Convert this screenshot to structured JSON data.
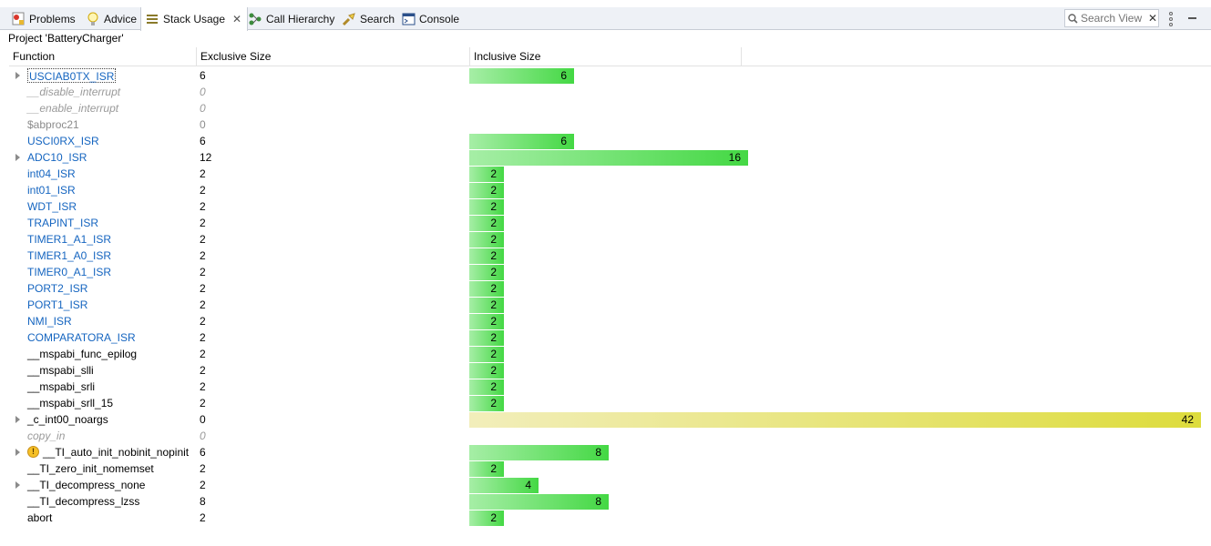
{
  "tabs": [
    {
      "label": "Problems",
      "icon": "problems-icon"
    },
    {
      "label": "Advice",
      "icon": "lightbulb-icon"
    },
    {
      "label": "Stack Usage",
      "icon": "stack-usage-icon",
      "active": true
    },
    {
      "label": "Call Hierarchy",
      "icon": "call-hierarchy-icon"
    },
    {
      "label": "Search",
      "icon": "search-flashlight-icon"
    },
    {
      "label": "Console",
      "icon": "console-icon"
    }
  ],
  "search_view": {
    "placeholder": "Search View"
  },
  "project_label": "Project 'BatteryCharger'",
  "columns": {
    "function": "Function",
    "exclusive": "Exclusive Size",
    "inclusive": "Inclusive Size"
  },
  "bar_scale_max": 42,
  "colors": {
    "link": "#1565c0",
    "bar_green": "#44d844",
    "bar_yellow": "#dddc3c"
  },
  "rows": [
    {
      "name": "USCIAB0TX_ISR",
      "exclusive": "6",
      "inclusive": 6,
      "style": "link",
      "expandable": true,
      "selected": true
    },
    {
      "name": "__disable_interrupt",
      "exclusive": "0",
      "inclusive": null,
      "style": "muted"
    },
    {
      "name": "__enable_interrupt",
      "exclusive": "0",
      "inclusive": null,
      "style": "muted"
    },
    {
      "name": "$abproc21",
      "exclusive": "0",
      "inclusive": null,
      "style": "gray"
    },
    {
      "name": "USCI0RX_ISR",
      "exclusive": "6",
      "inclusive": 6,
      "style": "link"
    },
    {
      "name": "ADC10_ISR",
      "exclusive": "12",
      "inclusive": 16,
      "style": "link",
      "expandable": true
    },
    {
      "name": "int04_ISR",
      "exclusive": "2",
      "inclusive": 2,
      "style": "link"
    },
    {
      "name": "int01_ISR",
      "exclusive": "2",
      "inclusive": 2,
      "style": "link"
    },
    {
      "name": "WDT_ISR",
      "exclusive": "2",
      "inclusive": 2,
      "style": "link"
    },
    {
      "name": "TRAPINT_ISR",
      "exclusive": "2",
      "inclusive": 2,
      "style": "link"
    },
    {
      "name": "TIMER1_A1_ISR",
      "exclusive": "2",
      "inclusive": 2,
      "style": "link"
    },
    {
      "name": "TIMER1_A0_ISR",
      "exclusive": "2",
      "inclusive": 2,
      "style": "link"
    },
    {
      "name": "TIMER0_A1_ISR",
      "exclusive": "2",
      "inclusive": 2,
      "style": "link"
    },
    {
      "name": "PORT2_ISR",
      "exclusive": "2",
      "inclusive": 2,
      "style": "link"
    },
    {
      "name": "PORT1_ISR",
      "exclusive": "2",
      "inclusive": 2,
      "style": "link"
    },
    {
      "name": "NMI_ISR",
      "exclusive": "2",
      "inclusive": 2,
      "style": "link"
    },
    {
      "name": "COMPARATORA_ISR",
      "exclusive": "2",
      "inclusive": 2,
      "style": "link"
    },
    {
      "name": "__mspabi_func_epilog",
      "exclusive": "2",
      "inclusive": 2,
      "style": "plain"
    },
    {
      "name": "__mspabi_slli",
      "exclusive": "2",
      "inclusive": 2,
      "style": "plain"
    },
    {
      "name": "__mspabi_srli",
      "exclusive": "2",
      "inclusive": 2,
      "style": "plain"
    },
    {
      "name": "__mspabi_srll_15",
      "exclusive": "2",
      "inclusive": 2,
      "style": "plain"
    },
    {
      "name": "_c_int00_noargs",
      "exclusive": "0",
      "inclusive": 42,
      "style": "plain",
      "expandable": true,
      "bar": "yellow"
    },
    {
      "name": "copy_in",
      "exclusive": "0",
      "inclusive": null,
      "style": "muted"
    },
    {
      "name": "__TI_auto_init_nobinit_nopinit",
      "exclusive": "6",
      "inclusive": 8,
      "style": "plain",
      "expandable": true,
      "warning": true
    },
    {
      "name": "__TI_zero_init_nomemset",
      "exclusive": "2",
      "inclusive": 2,
      "style": "plain"
    },
    {
      "name": "__TI_decompress_none",
      "exclusive": "2",
      "inclusive": 4,
      "style": "plain",
      "expandable": true
    },
    {
      "name": "__TI_decompress_lzss",
      "exclusive": "8",
      "inclusive": 8,
      "style": "plain"
    },
    {
      "name": "abort",
      "exclusive": "2",
      "inclusive": 2,
      "style": "plain"
    }
  ]
}
